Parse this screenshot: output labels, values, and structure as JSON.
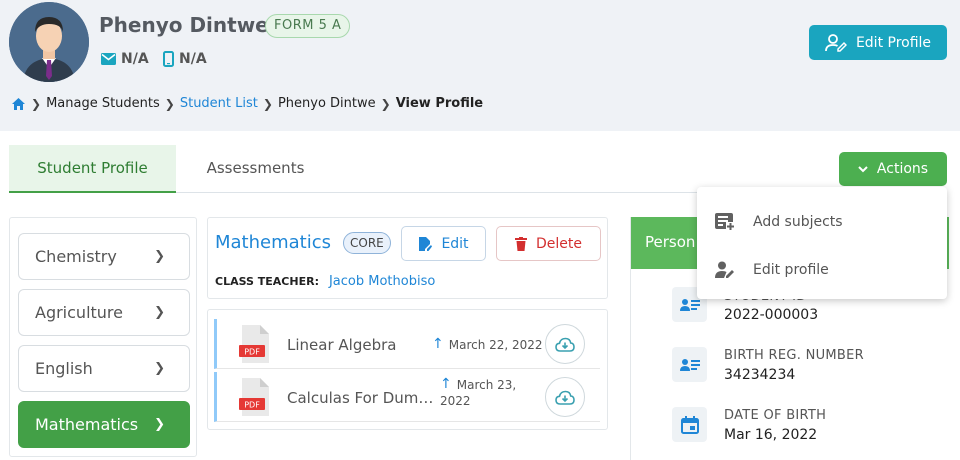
{
  "student": {
    "name": "Phenyo Dintwe",
    "form": "FORM 5 A",
    "email": "N/A",
    "phone": "N/A"
  },
  "header": {
    "edit_profile_label": "Edit Profile"
  },
  "breadcrumb": [
    "Manage Students",
    "Student List",
    "Phenyo Dintwe",
    "View Profile"
  ],
  "tabs": [
    "Student Profile",
    "Assessments"
  ],
  "actions": {
    "label": "Actions",
    "menu": [
      {
        "label": "Add subjects",
        "icon": "add-list-icon"
      },
      {
        "label": "Edit profile",
        "icon": "person-edit-icon"
      }
    ]
  },
  "subjects": [
    {
      "name": "Chemistry",
      "active": false
    },
    {
      "name": "Agriculture",
      "active": false
    },
    {
      "name": "English",
      "active": false
    },
    {
      "name": "Mathematics",
      "active": true
    }
  ],
  "selected_subject": {
    "name": "Mathematics",
    "badge": "CORE",
    "edit_label": "Edit",
    "delete_label": "Delete",
    "teacher_label": "CLASS TEACHER:",
    "teacher": "Jacob Mothobiso"
  },
  "files": [
    {
      "name": "Linear Algebra",
      "date": "March 22, 2022",
      "type": "PDF"
    },
    {
      "name": "Calculas For Dummies",
      "date_line1": "March 23,",
      "date_line2": "2022",
      "type": "PDF"
    }
  ],
  "personal": {
    "title": "Person",
    "fields": [
      {
        "label": "STUDENT ID",
        "value": "2022-000003",
        "icon": "id-card-icon"
      },
      {
        "label": "BIRTH REG. NUMBER",
        "value": "34234234",
        "icon": "id-card-icon"
      },
      {
        "label": "DATE OF BIRTH",
        "value": "Mar 16, 2022",
        "icon": "calendar-icon"
      }
    ]
  },
  "colors": {
    "primary_green": "#43a047",
    "teal": "#1aa5bf",
    "link_blue": "#1f86d6",
    "danger": "#d32f2f"
  }
}
